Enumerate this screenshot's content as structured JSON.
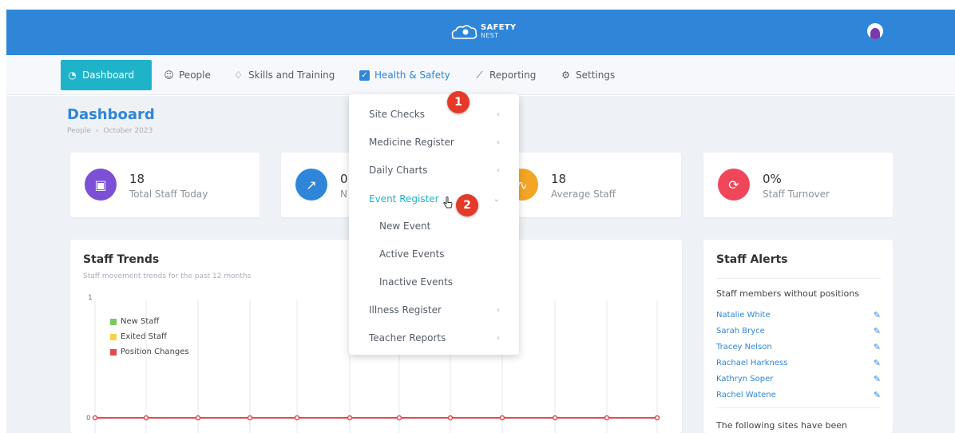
{
  "header": {
    "logo_line1": "SAFETY",
    "logo_line2": "NEST"
  },
  "nav": {
    "dashboard": "Dashboard",
    "people": "People",
    "skills": "Skills and Training",
    "health_safety": "Health & Safety",
    "reporting": "Reporting",
    "settings": "Settings"
  },
  "page": {
    "title": "Dashboard",
    "breadcrumb_1": "People",
    "breadcrumb_2": "October 2023"
  },
  "stats": [
    {
      "value": "18",
      "label": "Total Staff Today",
      "color": "#7b4fd6"
    },
    {
      "value": "0",
      "label": "N",
      "color": "#2f86d9"
    },
    {
      "value": "18",
      "label": "Average Staff",
      "color": "#f5a524"
    },
    {
      "value": "0%",
      "label": "Staff Turnover",
      "color": "#f0465a"
    }
  ],
  "trends": {
    "title": "Staff Trends",
    "subtitle": "Staff movement trends for the past 12 months",
    "y_top": "1",
    "y_bottom": "0",
    "legend": [
      {
        "name": "New Staff",
        "color": "#7bc862"
      },
      {
        "name": "Exited Staff",
        "color": "#f5d547"
      },
      {
        "name": "Position Changes",
        "color": "#e24b4b"
      }
    ]
  },
  "alerts": {
    "title": "Staff Alerts",
    "subtitle": "Staff members without positions",
    "people": [
      "Natalie White",
      "Sarah Bryce",
      "Tracey Nelson",
      "Rachael Harkness",
      "Kathryn Soper",
      "Rachel Watene"
    ],
    "footer": "The following sites have been"
  },
  "dropdown": {
    "site_checks": "Site Checks",
    "medicine": "Medicine Register",
    "daily_charts": "Daily Charts",
    "event_register": "Event Register",
    "new_event": "New Event",
    "active_events": "Active Events",
    "inactive_events": "Inactive Events",
    "illness": "Illness Register",
    "teacher_reports": "Teacher Reports"
  },
  "badges": {
    "one": "1",
    "two": "2"
  }
}
